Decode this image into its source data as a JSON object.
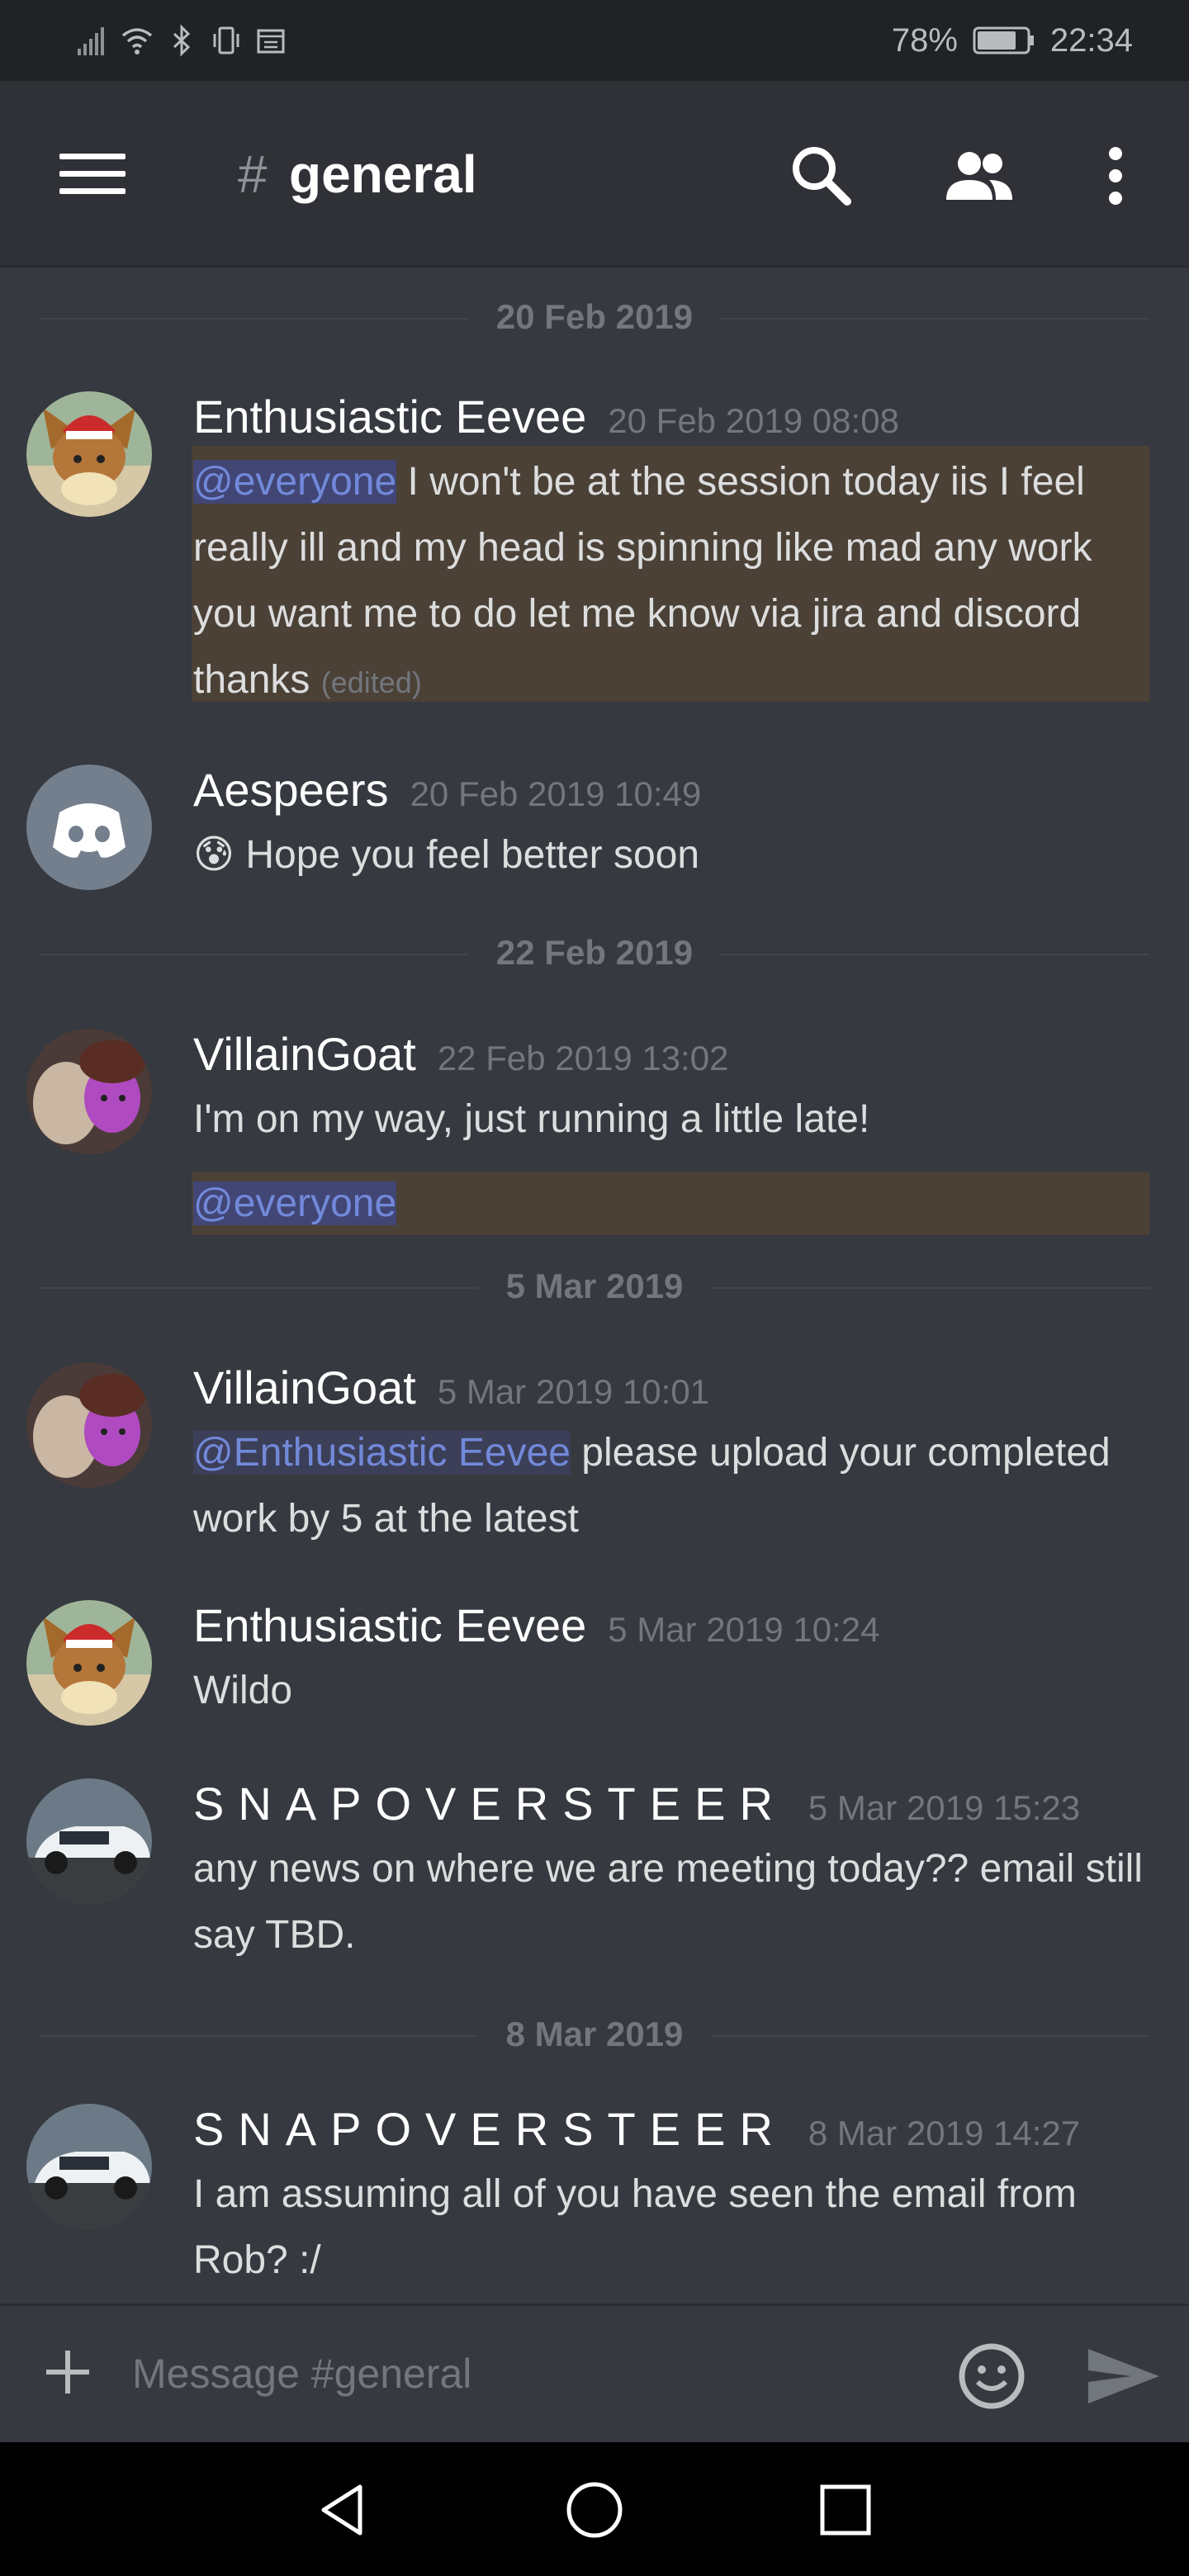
{
  "status_bar": {
    "battery": "78%",
    "time": "22:34",
    "icons": [
      "signal-icon",
      "wifi-icon",
      "bluetooth-icon",
      "vibrate-icon",
      "calendar-icon",
      "battery-icon"
    ]
  },
  "header": {
    "channel_hash": "#",
    "channel_name": "general",
    "icons": [
      "menu-icon",
      "search-icon",
      "members-icon",
      "more-icon"
    ]
  },
  "date_separators": [
    "20 Feb 2019",
    "22 Feb 2019",
    "5 Mar 2019",
    "8 Mar 2019"
  ],
  "messages": [
    {
      "author": "Enthusiastic Eevee",
      "timestamp": "20 Feb 2019 08:08",
      "mention": "@everyone",
      "text": " I won't be at the session today iis I feel really ill and my head is spinning like mad any work you want me to do let me know via jira and discord thanks ",
      "edited": "(edited)"
    },
    {
      "author": "Aespeers",
      "timestamp": "20 Feb 2019 10:49",
      "emoji": "😰",
      "text": " Hope you feel better soon"
    },
    {
      "author": "VillainGoat",
      "timestamp": "22 Feb 2019 13:02",
      "text": "I'm on my way, just running a little late!",
      "mention": "@everyone"
    },
    {
      "author": "VillainGoat",
      "timestamp": "5 Mar 2019 10:01",
      "mention": "@Enthusiastic Eevee",
      "text": " please upload your completed work by 5 at the latest"
    },
    {
      "author": "Enthusiastic Eevee",
      "timestamp": "5 Mar 2019 10:24",
      "text": "Wildo"
    },
    {
      "author": "SNAPOVERSTEER",
      "timestamp": "5 Mar 2019 15:23",
      "text": "any news on where we are meeting today?? email still say TBD."
    },
    {
      "author": "SNAPOVERSTEER",
      "timestamp": "8 Mar 2019 14:27",
      "text": "I am assuming all of you have seen the email from Rob? :/"
    }
  ],
  "input": {
    "placeholder": "Message #general",
    "icons": [
      "plus-icon",
      "emoji-icon",
      "send-icon"
    ]
  },
  "nav_bar": {
    "icons": [
      "back-icon",
      "home-icon",
      "recents-icon"
    ]
  },
  "colors": {
    "background": "#36393f",
    "header": "#2f3136",
    "mention_text": "#7289da",
    "mention_highlight": "#4b4136"
  }
}
